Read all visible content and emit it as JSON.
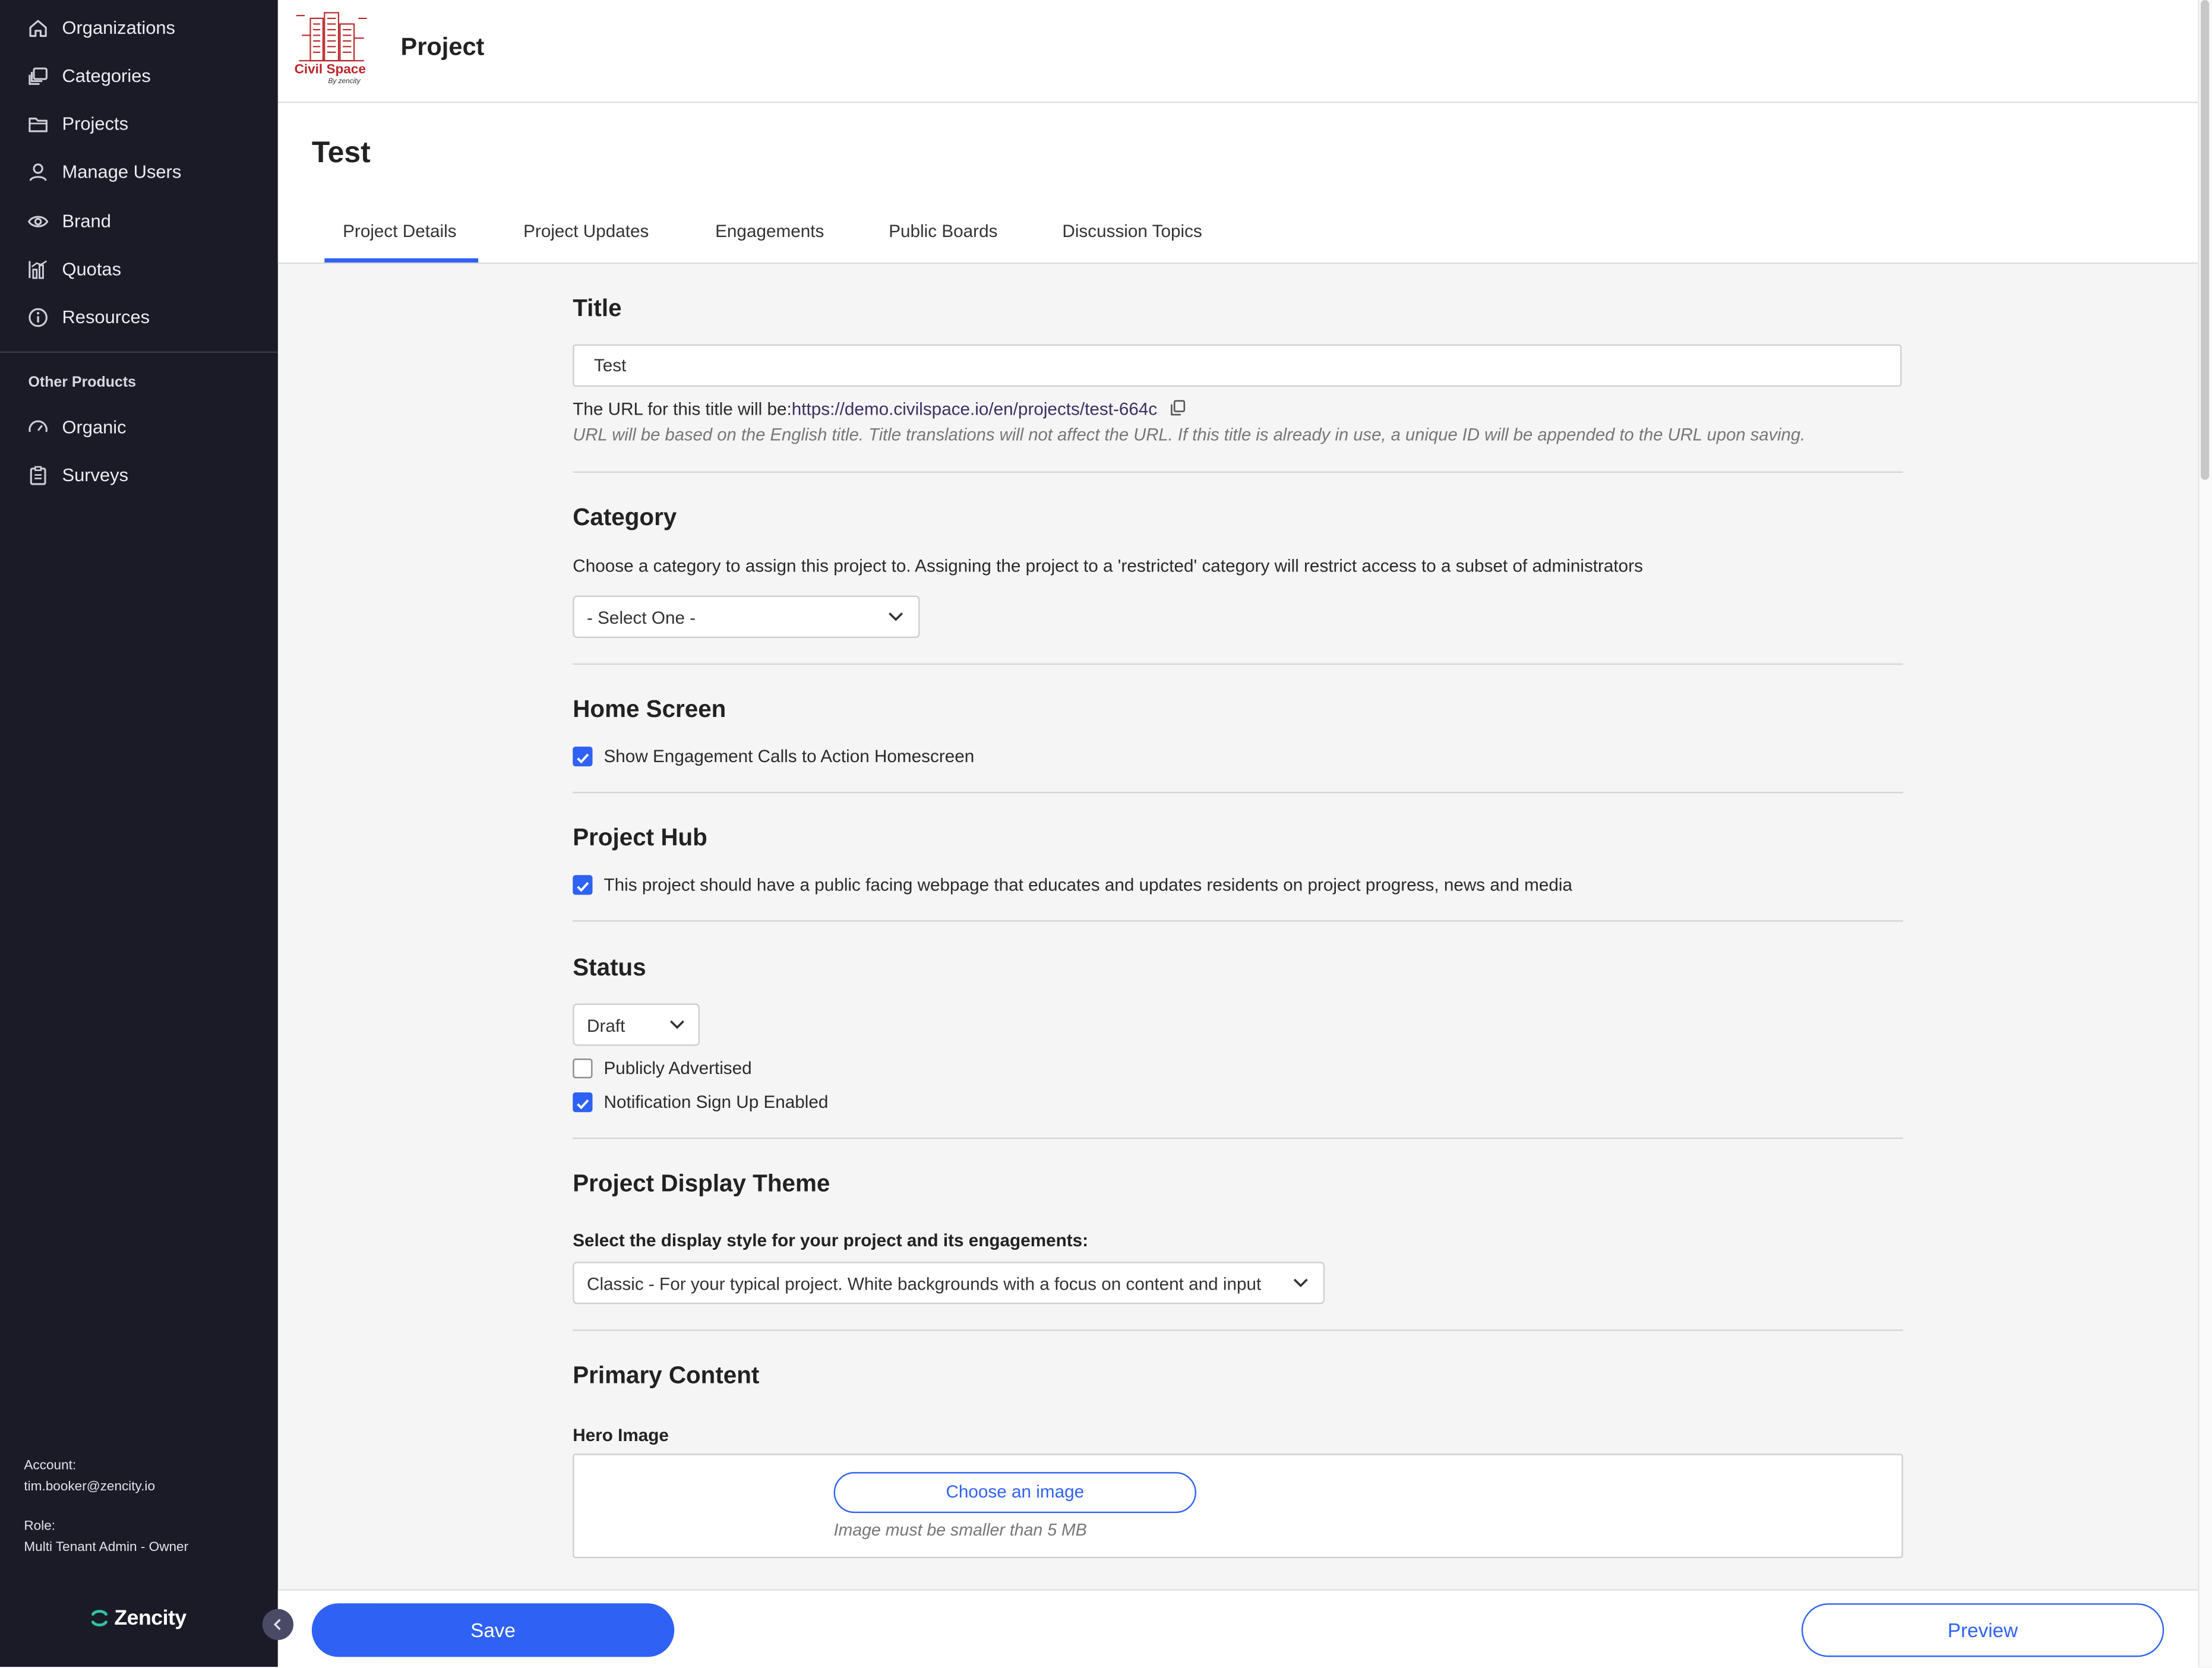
{
  "sidebar": {
    "items": [
      {
        "label": "Organizations",
        "icon": "home-icon"
      },
      {
        "label": "Categories",
        "icon": "stack-icon"
      },
      {
        "label": "Projects",
        "icon": "folder-icon"
      },
      {
        "label": "Manage Users",
        "icon": "user-icon"
      },
      {
        "label": "Brand",
        "icon": "eye-icon"
      },
      {
        "label": "Quotas",
        "icon": "bar-chart-icon"
      },
      {
        "label": "Resources",
        "icon": "info-icon"
      }
    ],
    "other_products_heading": "Other Products",
    "other_products": [
      {
        "label": "Organic",
        "icon": "gauge-icon"
      },
      {
        "label": "Surveys",
        "icon": "clipboard-icon"
      }
    ],
    "account_label": "Account:",
    "account_value": "tim.booker@zencity.io",
    "role_label": "Role:",
    "role_value": "Multi Tenant Admin - Owner",
    "brand_name": "Zencity"
  },
  "header": {
    "app_title": "Project",
    "logo_text": "Civil Space",
    "logo_subtext": "By zencity"
  },
  "page": {
    "title": "Test",
    "tabs": [
      {
        "label": "Project Details",
        "active": true
      },
      {
        "label": "Project Updates",
        "active": false
      },
      {
        "label": "Engagements",
        "active": false
      },
      {
        "label": "Public Boards",
        "active": false
      },
      {
        "label": "Discussion Topics",
        "active": false
      }
    ]
  },
  "form": {
    "title_section": {
      "heading": "Title",
      "value": "Test",
      "url_prefix": "The URL for this title will be:",
      "url": "https://demo.civilspace.io/en/projects/test-664c",
      "note": "URL will be based on the English title. Title translations will not affect the URL. If this title is already in use, a unique ID will be appended to the URL upon saving."
    },
    "category_section": {
      "heading": "Category",
      "description": "Choose a category to assign this project to. Assigning the project to a 'restricted' category will restrict access to a subset of administrators",
      "selected": "- Select One -"
    },
    "home_screen": {
      "heading": "Home Screen",
      "checkbox_label": "Show Engagement Calls to Action Homescreen",
      "checked": true
    },
    "project_hub": {
      "heading": "Project Hub",
      "checkbox_label": "This project should have a public facing webpage that educates and updates residents on project progress, news and media",
      "checked": true
    },
    "status": {
      "heading": "Status",
      "selected": "Draft",
      "publicly_advertised_label": "Publicly Advertised",
      "publicly_advertised": false,
      "notification_label": "Notification Sign Up Enabled",
      "notification": true
    },
    "display_theme": {
      "heading": "Project Display Theme",
      "prompt": "Select the display style for your project and its engagements:",
      "selected": "Classic - For your typical project. White backgrounds with a focus on content and input"
    },
    "primary_content": {
      "heading": "Primary Content",
      "hero_label": "Hero Image",
      "choose_button": "Choose an image",
      "size_note": "Image must be smaller than 5 MB"
    }
  },
  "footer": {
    "save_label": "Save",
    "preview_label": "Preview"
  },
  "colors": {
    "accent": "#2f62f4",
    "sidebar_bg": "#1b1b27",
    "brand_red": "#b8262b",
    "brand_teal": "#2ec4a8"
  }
}
